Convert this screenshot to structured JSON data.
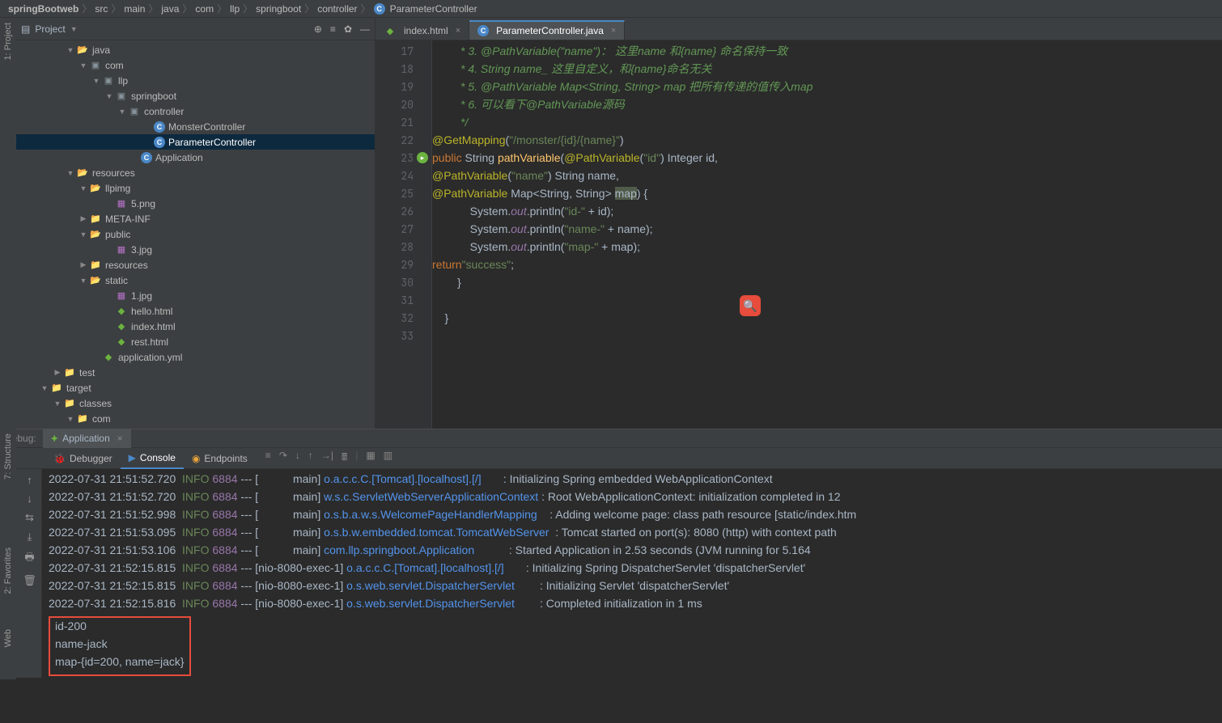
{
  "breadcrumb": [
    "springBootweb",
    "src",
    "main",
    "java",
    "com",
    "llp",
    "springboot",
    "controller"
  ],
  "breadcrumb_file": "ParameterController",
  "project": {
    "title": "Project",
    "tree": [
      {
        "indent": 60,
        "tw": "▼",
        "icon": "folder-open",
        "label": "java"
      },
      {
        "indent": 76,
        "tw": "▼",
        "icon": "pkg",
        "label": "com"
      },
      {
        "indent": 92,
        "tw": "▼",
        "icon": "pkg",
        "label": "llp"
      },
      {
        "indent": 108,
        "tw": "▼",
        "icon": "pkg",
        "label": "springboot"
      },
      {
        "indent": 124,
        "tw": "▼",
        "icon": "pkg",
        "label": "controller"
      },
      {
        "indent": 156,
        "tw": "",
        "icon": "class",
        "label": "MonsterController"
      },
      {
        "indent": 156,
        "tw": "",
        "icon": "class",
        "label": "ParameterController",
        "selected": true
      },
      {
        "indent": 140,
        "tw": "",
        "icon": "class",
        "label": "Application"
      },
      {
        "indent": 60,
        "tw": "▼",
        "icon": "folder-open",
        "label": "resources"
      },
      {
        "indent": 76,
        "tw": "▼",
        "icon": "folder-open",
        "label": "llpimg"
      },
      {
        "indent": 108,
        "tw": "",
        "icon": "img",
        "label": "5.png"
      },
      {
        "indent": 76,
        "tw": "▶",
        "icon": "folder",
        "label": "META-INF"
      },
      {
        "indent": 76,
        "tw": "▼",
        "icon": "folder-open",
        "label": "public"
      },
      {
        "indent": 108,
        "tw": "",
        "icon": "img",
        "label": "3.jpg"
      },
      {
        "indent": 76,
        "tw": "▶",
        "icon": "folder",
        "label": "resources"
      },
      {
        "indent": 76,
        "tw": "▼",
        "icon": "folder-open",
        "label": "static"
      },
      {
        "indent": 108,
        "tw": "",
        "icon": "img",
        "label": "1.jpg"
      },
      {
        "indent": 108,
        "tw": "",
        "icon": "html",
        "label": "hello.html"
      },
      {
        "indent": 108,
        "tw": "",
        "icon": "html",
        "label": "index.html"
      },
      {
        "indent": 108,
        "tw": "",
        "icon": "html",
        "label": "rest.html"
      },
      {
        "indent": 92,
        "tw": "",
        "icon": "yml",
        "label": "application.yml"
      },
      {
        "indent": 44,
        "tw": "▶",
        "icon": "folder",
        "label": "test"
      },
      {
        "indent": 28,
        "tw": "▼",
        "icon": "folder-orange",
        "label": "target"
      },
      {
        "indent": 44,
        "tw": "▼",
        "icon": "folder-orange",
        "label": "classes"
      },
      {
        "indent": 60,
        "tw": "▼",
        "icon": "folder-orange",
        "label": "com"
      },
      {
        "indent": 76,
        "tw": "▶",
        "icon": "folder-orange",
        "label": "llp"
      }
    ]
  },
  "tabs": [
    {
      "icon": "html",
      "label": "index.html",
      "active": false
    },
    {
      "icon": "class",
      "label": "ParameterController.java",
      "active": true
    }
  ],
  "lines": [
    17,
    18,
    19,
    20,
    21,
    22,
    23,
    24,
    25,
    26,
    27,
    28,
    29,
    30,
    31,
    32,
    33
  ],
  "code": {
    "l17": "         * 3. @PathVariable(\"name\")： 这里name 和{name} 命名保持一致",
    "l18": "         * 4. String name_ 这里自定义，和{name}命名无关",
    "l19": "         * 5. @PathVariable Map<String, String> map 把所有传递的值传入map",
    "l20": "         * 6. 可以看下@PathVariable源码",
    "l21": "         */"
  },
  "debug": {
    "label": "Debug:",
    "app": "Application",
    "tabs": [
      "Debugger",
      "Console",
      "Endpoints"
    ]
  },
  "console": [
    {
      "ts": "2022-07-31 21:51:52.720",
      "lvl": "INFO",
      "pid": "6884",
      "thread": "[           main]",
      "logger": "o.a.c.c.C.[Tomcat].[localhost].[/]      ",
      "msg": ": Initializing Spring embedded WebApplicationContext"
    },
    {
      "ts": "2022-07-31 21:51:52.720",
      "lvl": "INFO",
      "pid": "6884",
      "thread": "[           main]",
      "logger": "w.s.c.ServletWebServerApplicationContext",
      "msg": ": Root WebApplicationContext: initialization completed in 12"
    },
    {
      "ts": "2022-07-31 21:51:52.998",
      "lvl": "INFO",
      "pid": "6884",
      "thread": "[           main]",
      "logger": "o.s.b.a.w.s.WelcomePageHandlerMapping   ",
      "msg": ": Adding welcome page: class path resource [static/index.htm"
    },
    {
      "ts": "2022-07-31 21:51:53.095",
      "lvl": "INFO",
      "pid": "6884",
      "thread": "[           main]",
      "logger": "o.s.b.w.embedded.tomcat.TomcatWebServer ",
      "msg": ": Tomcat started on port(s): 8080 (http) with context path "
    },
    {
      "ts": "2022-07-31 21:51:53.106",
      "lvl": "INFO",
      "pid": "6884",
      "thread": "[           main]",
      "logger": "com.llp.springboot.Application          ",
      "msg": ": Started Application in 2.53 seconds (JVM running for 5.164"
    },
    {
      "ts": "2022-07-31 21:52:15.815",
      "lvl": "INFO",
      "pid": "6884",
      "thread": "[nio-8080-exec-1]",
      "logger": "o.a.c.c.C.[Tomcat].[localhost].[/]      ",
      "msg": ": Initializing Spring DispatcherServlet 'dispatcherServlet'"
    },
    {
      "ts": "2022-07-31 21:52:15.815",
      "lvl": "INFO",
      "pid": "6884",
      "thread": "[nio-8080-exec-1]",
      "logger": "o.s.web.servlet.DispatcherServlet       ",
      "msg": ": Initializing Servlet 'dispatcherServlet'"
    },
    {
      "ts": "2022-07-31 21:52:15.816",
      "lvl": "INFO",
      "pid": "6884",
      "thread": "[nio-8080-exec-1]",
      "logger": "o.s.web.servlet.DispatcherServlet       ",
      "msg": ": Completed initialization in 1 ms"
    }
  ],
  "output": {
    "l1": "id-200",
    "l2": "name-jack",
    "l3": "map-{id=200, name=jack}"
  },
  "sidebar_labels": {
    "project": "1: Project",
    "structure": "7: Structure",
    "favorites": "2: Favorites",
    "web": "Web"
  }
}
